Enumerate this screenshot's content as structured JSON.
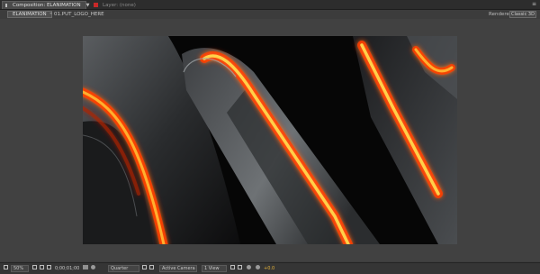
{
  "tab_bar": {
    "active_tab_label": "Composition: ELANIMATION",
    "inactive_tab_label": "Layer: (none)"
  },
  "toolbar": {
    "comp_tab": "ELANIMATION",
    "separator": "◂",
    "comp_tab_2": "01.PUT_LOGO_HERE",
    "renderer_label": "Renderer:",
    "renderer_value": "Classic 3D"
  },
  "bottom_bar": {
    "zoom": "50%",
    "timecode": "0;00;01;00",
    "resolution": "Quarter",
    "view": "Active Camera",
    "view_count": "1 View",
    "exposure": "+0.0"
  },
  "colors": {
    "glow_orange": "#ff6a00",
    "glow_core": "#ffd84a",
    "ui_bg": "#3c3c3c"
  }
}
